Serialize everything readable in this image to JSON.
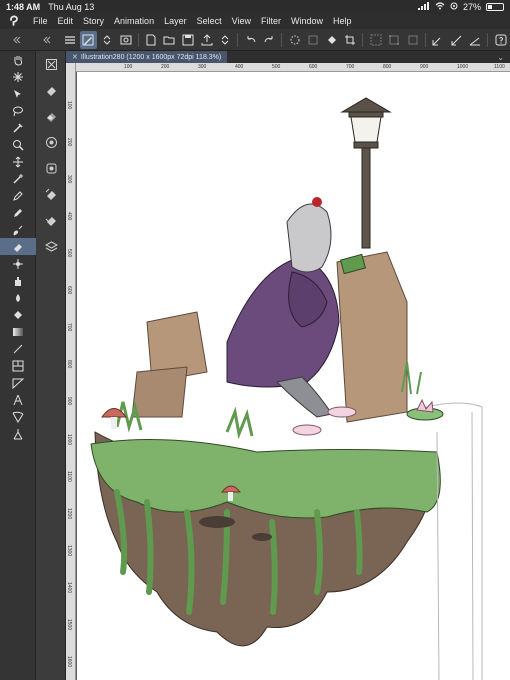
{
  "status": {
    "time": "1:48 AM",
    "date": "Thu Aug 13",
    "battery": "27%"
  },
  "menu": [
    "File",
    "Edit",
    "Story",
    "Animation",
    "Layer",
    "Select",
    "View",
    "Filter",
    "Window",
    "Help"
  ],
  "document_tab": {
    "label": "Illustration280 (1200 x 1600px 72dpi 118.3%)"
  },
  "ruler": {
    "h_labels": [
      "100",
      "200",
      "300",
      "400",
      "500",
      "600",
      "700",
      "800",
      "900",
      "1000",
      "1100"
    ],
    "v_labels": [
      "100",
      "200",
      "300",
      "400",
      "500",
      "600",
      "700",
      "800",
      "900",
      "1000",
      "1100",
      "1200",
      "1300",
      "1400",
      "1500",
      "1600"
    ]
  },
  "accent_color": "#5a6e8a",
  "icons": {
    "tools": [
      "hand-icon",
      "sparkle-icon",
      "move-select-icon",
      "lasso-icon",
      "eyedropper-icon",
      "zoom-icon",
      "move-icon",
      "magic-wand-icon",
      "pen-icon",
      "pencil-icon",
      "brush-icon",
      "eraser-icon",
      "blend-icon",
      "airbrush-icon",
      "decoration-icon",
      "fill-icon",
      "gradient-icon",
      "line-icon",
      "frame-icon",
      "ruler-icon",
      "text-icon",
      "balloon-icon",
      "correct-line-icon"
    ],
    "subtools": [
      "eraser-sub-icon",
      "hard-eraser-icon",
      "soft-eraser-icon",
      "vector-eraser-icon",
      "snap-eraser-icon",
      "layer-eraser-icon",
      "stack-icon",
      "layers-icon"
    ]
  }
}
